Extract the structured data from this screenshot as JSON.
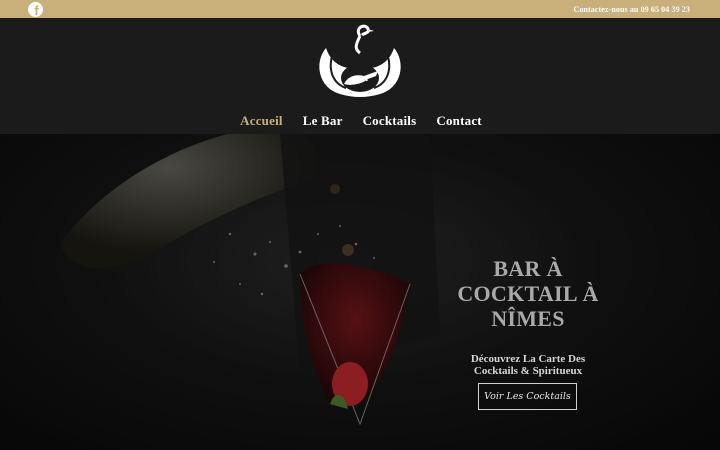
{
  "topbar": {
    "facebook_icon": "facebook-icon",
    "contact": "Contactez-nous au 09 65 04 39 23",
    "accent_color": "#c9b07a"
  },
  "logo": {
    "icon": "swan-crocodile-logo"
  },
  "nav": {
    "items": [
      {
        "label": "Accueil",
        "active": true
      },
      {
        "label": "Le Bar",
        "active": false
      },
      {
        "label": "Cocktails",
        "active": false
      },
      {
        "label": "Contact",
        "active": false
      }
    ]
  },
  "hero": {
    "title": "BAR À\nCOCKTAIL À\nNÎMES",
    "subtitle": "Découvrez La Carte Des\nCocktails & Spiritueux",
    "cta_label": "Voir Les Cocktails"
  }
}
